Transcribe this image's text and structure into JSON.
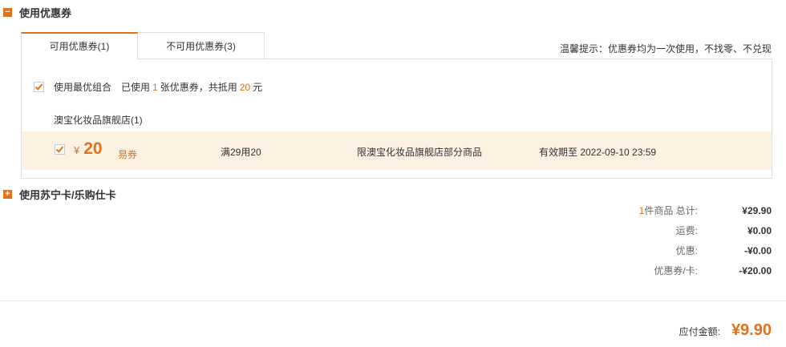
{
  "coupon_section": {
    "toggle": "−",
    "title": "使用优惠券"
  },
  "tabs": [
    {
      "label": "可用优惠券(1)"
    },
    {
      "label": "不可用优惠券(3)"
    }
  ],
  "tip": "温馨提示：优惠券均为一次使用，不找零、不兑现",
  "best_combo": {
    "label": "使用最优组合",
    "prefix": "已使用",
    "count": "1",
    "mid": "张优惠券，共抵用",
    "amount": "20",
    "suffix": "元",
    "checked": true
  },
  "store": {
    "name": "澳宝化妆品旗舰店(1)"
  },
  "coupon": {
    "currency": "¥",
    "amount": "20",
    "type": "易券",
    "condition": "满29用20",
    "scope": "限澳宝化妆品旗舰店部分商品",
    "expire": "有效期至 2022-09-10 23:59",
    "checked": true
  },
  "card_section": {
    "toggle": "+",
    "title": "使用苏宁卡/乐购仕卡"
  },
  "summary": {
    "items_count": "1",
    "items_label": "件商品 总计:",
    "items_total": "¥29.90",
    "shipping_label": "运费:",
    "shipping": "¥0.00",
    "discount_label": "优惠:",
    "discount": "-¥0.00",
    "coupon_label": "优惠券/卡:",
    "coupon": "-¥20.00"
  },
  "total": {
    "label": "应付金额:",
    "value": "¥9.90"
  },
  "colors": {
    "accent": "#e2711a",
    "coupon_bg": "#fdf1e2",
    "border": "#e0e0e0"
  }
}
